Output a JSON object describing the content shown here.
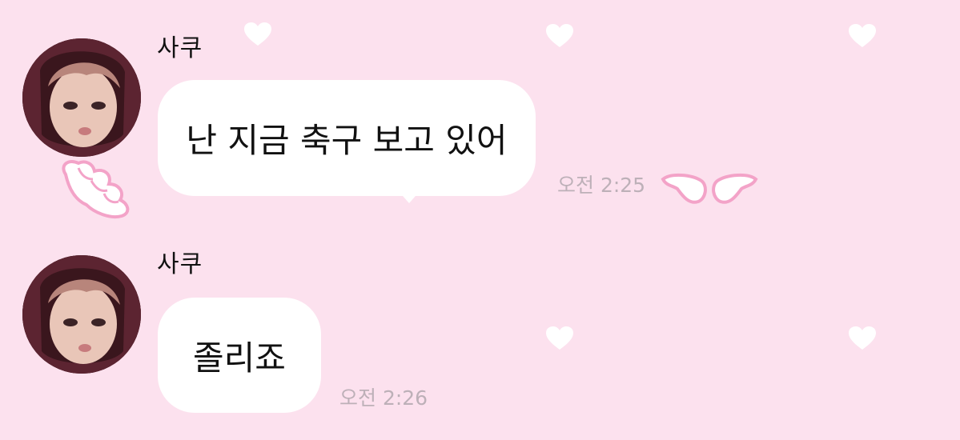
{
  "colors": {
    "background": "#fce1ee",
    "bubble": "#ffffff",
    "timestamp": "#bdb0b8",
    "decoration_outline": "#f3a3c8"
  },
  "messages": [
    {
      "sender": "사쿠",
      "avatar_icon": "profile-photo",
      "text": "난 지금 축구 보고 있어",
      "time": "오전 2:25"
    },
    {
      "sender": "사쿠",
      "avatar_icon": "profile-photo",
      "text": "졸리죠",
      "time": "오전 2:26"
    }
  ],
  "decorations": [
    "heart-icon",
    "wing-icon",
    "cloud-paw-icon"
  ]
}
